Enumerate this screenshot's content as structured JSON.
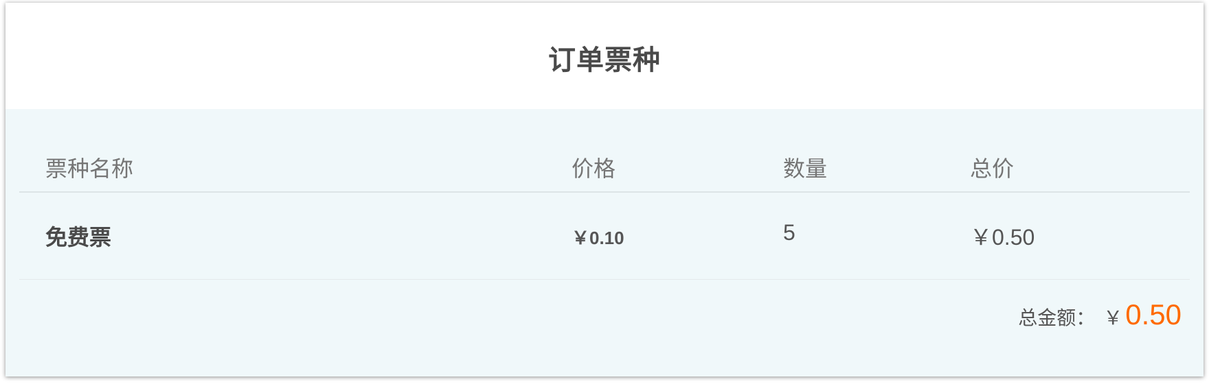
{
  "page": {
    "title": "订单票种"
  },
  "table": {
    "headers": {
      "name": "票种名称",
      "price": "价格",
      "quantity": "数量",
      "total": "总价"
    },
    "rows": [
      {
        "name": "免费票",
        "price": "￥0.10",
        "quantity": "5",
        "total": "￥0.50"
      }
    ]
  },
  "summary": {
    "label": "总金额：",
    "currency": "￥",
    "amount": "0.50"
  },
  "colors": {
    "accent": "#ff6a00",
    "panel_background": "#f0f8fa",
    "text": "#555555"
  }
}
